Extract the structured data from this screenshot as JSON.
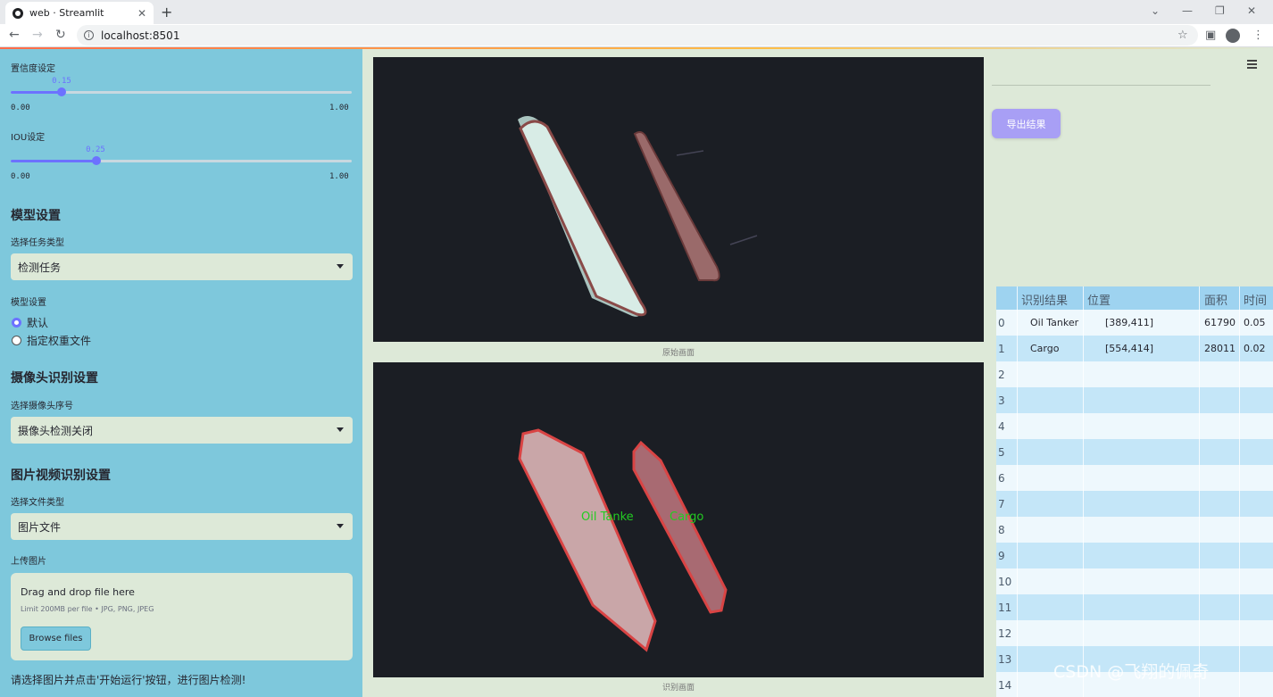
{
  "browser": {
    "tab_title": "web · Streamlit",
    "url": "localhost:8501"
  },
  "sidebar": {
    "conf": {
      "label": "置信度设定",
      "value": "0.15",
      "value_fraction": 0.15,
      "min": "0.00",
      "max": "1.00"
    },
    "iou": {
      "label": "IOU设定",
      "value": "0.25",
      "value_fraction": 0.25,
      "min": "0.00",
      "max": "1.00"
    },
    "model_section": "模型设置",
    "task_label": "选择任务类型",
    "task_value": "检测任务",
    "model_label": "模型设置",
    "model_options": [
      "默认",
      "指定权重文件"
    ],
    "camera_section": "摄像头识别设置",
    "camera_label": "选择摄像头序号",
    "camera_value": "摄像头检测关闭",
    "media_section": "图片视频识别设置",
    "file_type_label": "选择文件类型",
    "file_type_value": "图片文件",
    "upload_label": "上传图片",
    "uploader": {
      "title": "Drag and drop file here",
      "limit": "Limit 200MB per file • JPG, PNG, JPEG",
      "button": "Browse files"
    },
    "footer": "请选择图片并点击'开始运行'按钮，进行图片检测!"
  },
  "main": {
    "original_caption": "原始画面",
    "result_caption": "识别画面",
    "export_button": "导出结果",
    "detections": [
      {
        "label": "Oil Tanker",
        "display": "Oil Tanke"
      },
      {
        "label": "Cargo",
        "display": "Cargo"
      }
    ]
  },
  "table": {
    "headers": [
      "",
      "识别结果",
      "位置",
      "面积",
      "时间"
    ],
    "rows": [
      [
        "0",
        "Oil Tanker",
        "[389,411]",
        "61790",
        "0.05"
      ],
      [
        "1",
        "Cargo",
        "[554,414]",
        "28011",
        "0.02"
      ],
      [
        "2",
        "",
        "",
        "",
        ""
      ],
      [
        "3",
        "",
        "",
        "",
        ""
      ],
      [
        "4",
        "",
        "",
        "",
        ""
      ],
      [
        "5",
        "",
        "",
        "",
        ""
      ],
      [
        "6",
        "",
        "",
        "",
        ""
      ],
      [
        "7",
        "",
        "",
        "",
        ""
      ],
      [
        "8",
        "",
        "",
        "",
        ""
      ],
      [
        "9",
        "",
        "",
        "",
        ""
      ],
      [
        "10",
        "",
        "",
        "",
        ""
      ],
      [
        "11",
        "",
        "",
        "",
        ""
      ],
      [
        "12",
        "",
        "",
        "",
        ""
      ],
      [
        "13",
        "",
        "",
        "",
        ""
      ],
      [
        "14",
        "",
        "",
        "",
        ""
      ]
    ]
  },
  "watermark": "CSDN @飞翔的佩奇",
  "colors": {
    "sidebar": "#7ec8dc",
    "accent": "#6c72ff",
    "background": "#dde9d8",
    "detection_label": "#22cc22"
  }
}
